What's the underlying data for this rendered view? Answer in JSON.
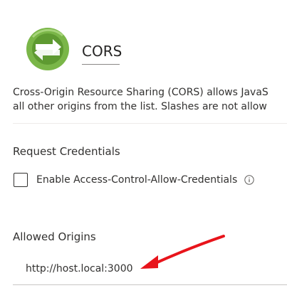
{
  "page": {
    "title": "CORS",
    "description_line1": "Cross-Origin Resource Sharing (CORS) allows JavaS",
    "description_line2": "all other origins from the list. Slashes are not allow"
  },
  "credentials": {
    "heading": "Request Credentials",
    "checkbox_label": "Enable Access-Control-Allow-Credentials",
    "checked": false,
    "info_icon": "info-icon"
  },
  "origins": {
    "heading": "Allowed Origins",
    "values": [
      "http://host.local:3000"
    ]
  },
  "colors": {
    "logo_green": "#7ab648",
    "annotation_arrow": "#e8141b"
  },
  "annotation": {
    "arrow_icon": "red-arrow-annotation"
  }
}
